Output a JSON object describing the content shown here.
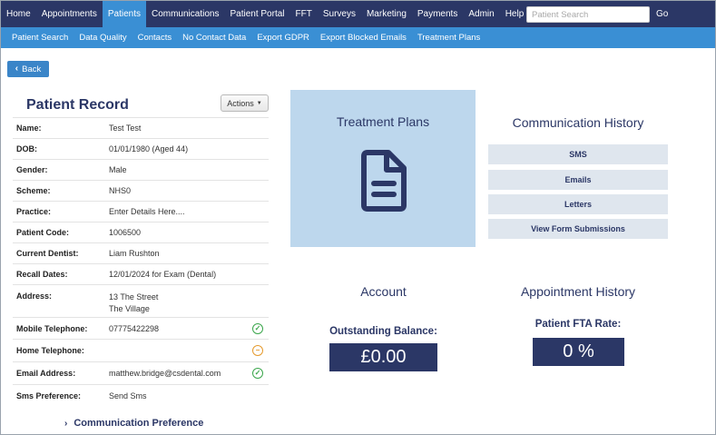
{
  "top_nav": {
    "items": [
      "Home",
      "Appointments",
      "Patients",
      "Communications",
      "Patient Portal",
      "FFT",
      "Surveys",
      "Marketing",
      "Payments",
      "Admin",
      "Help"
    ],
    "active": "Patients",
    "search_placeholder": "Patient Search",
    "go_label": "Go"
  },
  "sub_nav": {
    "items": [
      "Patient Search",
      "Data Quality",
      "Contacts",
      "No Contact Data",
      "Export GDPR",
      "Export Blocked Emails",
      "Treatment Plans"
    ]
  },
  "back_label": "Back",
  "record": {
    "title": "Patient Record",
    "actions_label": "Actions",
    "rows": [
      {
        "label": "Name:",
        "value": "Test Test"
      },
      {
        "label": "DOB:",
        "value": "01/01/1980 (Aged 44)"
      },
      {
        "label": "Gender:",
        "value": "Male"
      },
      {
        "label": "Scheme:",
        "value": "NHS0"
      },
      {
        "label": "Practice:",
        "value": "Enter Details Here...."
      },
      {
        "label": "Patient Code:",
        "value": "1006500"
      },
      {
        "label": "Current Dentist:",
        "value": "Liam Rushton"
      },
      {
        "label": "Recall Dates:",
        "value": "12/01/2024 for Exam (Dental)"
      },
      {
        "label": "Address:",
        "value": "13 The Street",
        "value2": "The Village"
      },
      {
        "label": "Mobile Telephone:",
        "value": "07775422298",
        "status": "ok"
      },
      {
        "label": "Home Telephone:",
        "value": "",
        "status": "warn"
      },
      {
        "label": "Email Address:",
        "value": "matthew.bridge@csdental.com",
        "status": "ok"
      },
      {
        "label": "Sms Preference:",
        "value": "Send Sms"
      }
    ],
    "comm_pref_label": "Communication Preference"
  },
  "treatment_plans": {
    "title": "Treatment Plans",
    "icon": "document-icon"
  },
  "communication_history": {
    "title": "Communication History",
    "buttons": [
      "SMS",
      "Emails",
      "Letters",
      "View Form Submissions"
    ]
  },
  "account": {
    "title": "Account",
    "label": "Outstanding Balance:",
    "value": "£0.00"
  },
  "appointment_history": {
    "title": "Appointment History",
    "label": "Patient FTA Rate:",
    "value": "0 %"
  },
  "colors": {
    "navy": "#2b3766",
    "blue": "#3a8fd4",
    "panel": "#bdd7ed",
    "ok": "#3aa64b",
    "warn": "#e59a2d"
  }
}
